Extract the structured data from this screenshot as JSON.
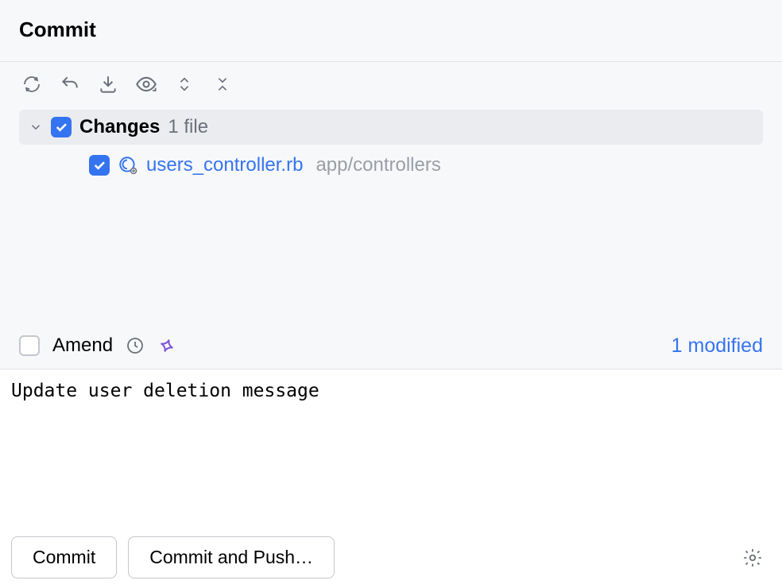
{
  "header": {
    "title": "Commit"
  },
  "changes": {
    "label": "Changes",
    "count_text": "1 file",
    "files": [
      {
        "name": "users_controller.rb",
        "path": "app/controllers"
      }
    ]
  },
  "amend": {
    "label": "Amend"
  },
  "status": {
    "modified": "1 modified"
  },
  "commit_message": "Update user deletion message",
  "buttons": {
    "commit": "Commit",
    "commit_push": "Commit and Push…"
  }
}
